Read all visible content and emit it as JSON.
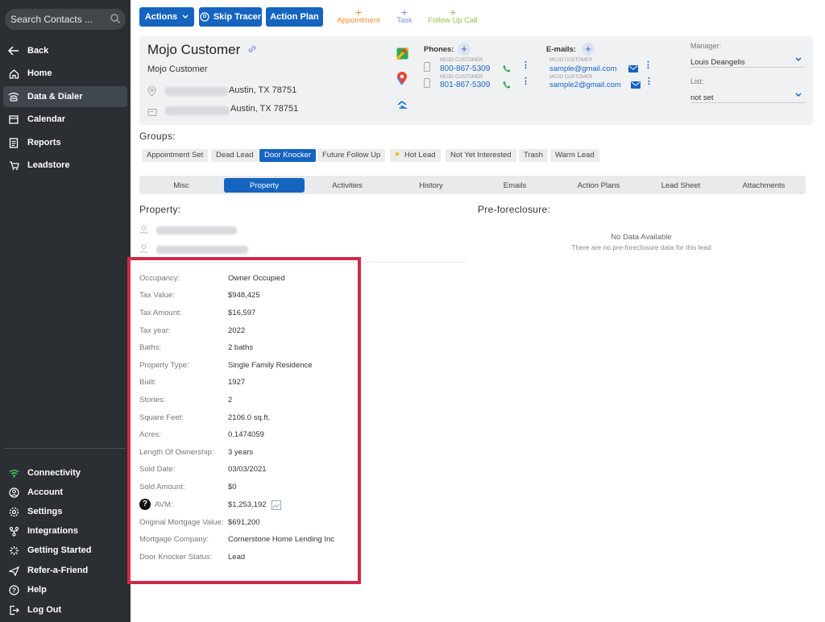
{
  "sidebar": {
    "search_placeholder": "Search Contacts ...",
    "nav": [
      {
        "label": "Back",
        "icon": "back-arrow-icon"
      },
      {
        "label": "Home",
        "icon": "home-icon"
      },
      {
        "label": "Data & Dialer",
        "icon": "data-dialer-icon"
      },
      {
        "label": "Calendar",
        "icon": "calendar-icon"
      },
      {
        "label": "Reports",
        "icon": "reports-icon"
      },
      {
        "label": "Leadstore",
        "icon": "leadstore-icon"
      }
    ],
    "bottom": [
      {
        "label": "Connectivity",
        "icon": "wifi-icon"
      },
      {
        "label": "Account",
        "icon": "account-icon"
      },
      {
        "label": "Settings",
        "icon": "gear-icon"
      },
      {
        "label": "Integrations",
        "icon": "integrations-icon"
      },
      {
        "label": "Getting Started",
        "icon": "getting-started-icon"
      },
      {
        "label": "Refer-a-Friend",
        "icon": "refer-icon"
      },
      {
        "label": "Help",
        "icon": "help-icon"
      },
      {
        "label": "Log Out",
        "icon": "logout-icon"
      }
    ]
  },
  "toolbar": {
    "actions": "Actions",
    "skip_tracer": "Skip Tracer",
    "action_plan": "Action Plan",
    "appointment": "Appointment",
    "task": "Task",
    "follow_up_call": "Follow Up Call"
  },
  "contact": {
    "name": "Mojo Customer",
    "subname": "Mojo Customer",
    "address1": "Austin, TX 78751",
    "address2": "Austin, TX 78751",
    "phones_label": "Phones:",
    "phones": [
      {
        "tag": "MOJO CUSTOMER",
        "number": "800-867-5309"
      },
      {
        "tag": "MOJO CUSTOMER",
        "number": "801-867-5309"
      }
    ],
    "emails_label": "E-mails:",
    "emails": [
      {
        "tag": "MOJO CUSTOMER",
        "email": "sample@gmail.com"
      },
      {
        "tag": "MOJO CUSTOMER",
        "email": "sample2@gmail.com"
      }
    ],
    "manager_label": "Manager:",
    "manager_value": "Louis Deangelis",
    "list_label": "List:",
    "list_value": "not set"
  },
  "groups": {
    "label": "Groups:",
    "items": [
      "Appointment Set",
      "Dead Lead",
      "Door Knocker",
      "Future Follow Up",
      "Hot Lead",
      "Not Yet Interested",
      "Trash",
      "Warm Lead"
    ],
    "active": "Door Knocker"
  },
  "tabs": [
    "Misc",
    "Property",
    "Activities",
    "History",
    "Emails",
    "Action Plans",
    "Lead Sheet",
    "Attachments"
  ],
  "active_tab": "Property",
  "property": {
    "heading": "Property:",
    "fields": [
      {
        "label": "Occupancy:",
        "value": "Owner Occupied"
      },
      {
        "label": "Tax Value:",
        "value": "$948,425"
      },
      {
        "label": "Tax Amount:",
        "value": "$16,597"
      },
      {
        "label": "Tax year:",
        "value": "2022"
      },
      {
        "label": "Baths:",
        "value": "2 baths"
      },
      {
        "label": "Property Type:",
        "value": "Single Family Residence"
      },
      {
        "label": "Built:",
        "value": "1927"
      },
      {
        "label": "Stories:",
        "value": "2"
      },
      {
        "label": "Square Feet:",
        "value": "2106.0 sq.ft."
      },
      {
        "label": "Acres:",
        "value": "0.1474059"
      },
      {
        "label": "Length Of Ownership:",
        "value": "3 years"
      },
      {
        "label": "Sold Date:",
        "value": "03/03/2021"
      },
      {
        "label": "Sold Amount:",
        "value": "$0"
      },
      {
        "label": "AVM:",
        "value": "$1,253,192"
      },
      {
        "label": "Original Mortgage Value:",
        "value": "$691,200"
      },
      {
        "label": "Mortgage Company:",
        "value": "Cornerstone Home Lending Inc"
      },
      {
        "label": "Door Knocker Status:",
        "value": "Lead"
      }
    ]
  },
  "preforeclosure": {
    "heading": "Pre-foreclosure:",
    "empty_title": "No Data Available",
    "empty_sub": "There are no pre-foreclosure data for this lead"
  },
  "colors": {
    "accent": "#1565c0",
    "sidebar": "#2b2f33",
    "highlight": "#cf2a48"
  }
}
